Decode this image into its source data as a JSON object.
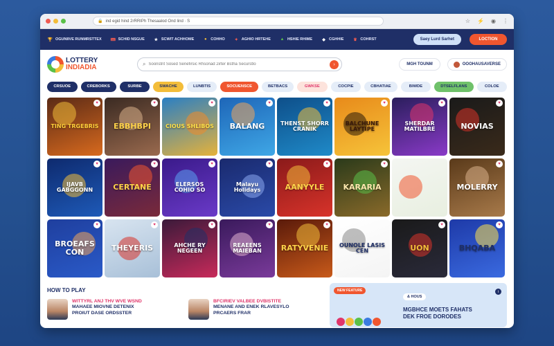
{
  "browser": {
    "url": "ind egid hind 2rRRIPh Thesaalod Ond lind · S",
    "icons": [
      "bookmark-icon",
      "extension-icon",
      "profile-icon",
      "menu-icon"
    ]
  },
  "topbar": {
    "promos": [
      {
        "label": "OGUNIIVE RUNMRSTTEX",
        "icon": "trophy-icon",
        "color": "#f3bd3a"
      },
      {
        "label": "SCHID NSGUE",
        "icon": "ticket-icon",
        "color": "#ef5b52"
      },
      {
        "label": "SCWIT ACHHOME",
        "icon": "star-icon",
        "color": "#ffffff"
      },
      {
        "label": "COHHO",
        "icon": "coin-icon",
        "color": "#f3bd3a"
      },
      {
        "label": "AGHIO HRTEHE",
        "icon": "gift-icon",
        "color": "#ef5b52"
      },
      {
        "label": "HSHIE RHIME",
        "icon": "chart-icon",
        "color": "#5ac048"
      },
      {
        "label": "CGHHIE",
        "icon": "dice-icon",
        "color": "#ffffff"
      },
      {
        "label": "COHRST",
        "icon": "crown-icon",
        "color": "#ef5b52"
      }
    ],
    "signup_label": "Saey Lurd Sarhet",
    "login_label": "LOCTION"
  },
  "header": {
    "logo_line1": "LOTTERY",
    "logo_line2": "INDIADIA",
    "search_placeholder": "Soonstnt Sosed Senefirsic Rhsonad 2irter Bstha Securstlo",
    "link1": "MGH TOUNM",
    "user_label": "OOOHAUSAVERSE"
  },
  "categories": [
    {
      "label": "CRSUOE",
      "bg": "#1f2f67",
      "fg": "#ffffff"
    },
    {
      "label": "CREBORKS",
      "bg": "#1f2f67",
      "fg": "#ffffff"
    },
    {
      "label": "SURBE",
      "bg": "#1f2f67",
      "fg": "#ffffff"
    },
    {
      "label": "SWACHE",
      "bg": "#f3bd3a",
      "fg": "#1f2f67"
    },
    {
      "label": "LUNBTIS",
      "bg": "#e5edf8",
      "fg": "#1f2f67"
    },
    {
      "label": "SOCUENSCE",
      "bg": "#f0562f",
      "fg": "#ffffff"
    },
    {
      "label": "BETBACS",
      "bg": "#e5edf8",
      "fg": "#1f2f67"
    },
    {
      "label": "GWKSE",
      "bg": "#fde3dc",
      "fg": "#e0356a"
    },
    {
      "label": "COCPIE",
      "bg": "#e5edf8",
      "fg": "#1f2f67"
    },
    {
      "label": "CBHATIAE",
      "bg": "#e5edf8",
      "fg": "#1f2f67"
    },
    {
      "label": "BIWDE",
      "bg": "#e5edf8",
      "fg": "#1f2f67"
    },
    {
      "label": "DTSELFLANS",
      "bg": "#6fc16a",
      "fg": "#1f2f67"
    },
    {
      "label": "COLOE",
      "bg": "#e5edf8",
      "fg": "#1f2f67"
    }
  ],
  "games": [
    {
      "label": "TING TRGEBRIS",
      "bg1": "#5a2a16",
      "bg2": "#d86a1e",
      "fg": "#ffcf3a",
      "deco": "#f3bd3a"
    },
    {
      "label": "EBBHBPI",
      "bg1": "#3a2a22",
      "bg2": "#9a6a4e",
      "fg": "#ffd34a",
      "deco": "#d8b08a"
    },
    {
      "label": "CIOUS SHLIBOS",
      "bg1": "#2a7fc4",
      "bg2": "#e6b23a",
      "fg": "#ffe14a",
      "deco": "#f08a2a"
    },
    {
      "label": "BALANG",
      "bg1": "#1e66b8",
      "bg2": "#3fa7e6",
      "fg": "#ffffff",
      "deco": "#f0a45a"
    },
    {
      "label": "THENST SHORR CRANIK",
      "bg1": "#0e4f8a",
      "bg2": "#1f8ac8",
      "fg": "#ffffff",
      "deco": "#f3bd3a"
    },
    {
      "label": "BALCHUNE LAYTIPE",
      "bg1": "#e88a1a",
      "bg2": "#f6c43a",
      "fg": "#3a1a0a",
      "deco": "#2a1a0a"
    },
    {
      "label": "SHERDAR MATILBRE",
      "bg1": "#2a1e5c",
      "bg2": "#8a3ac8",
      "fg": "#ffffff",
      "deco": "#e0356a"
    },
    {
      "label": "NOVIAS",
      "bg1": "#1a1a1a",
      "bg2": "#3a2a1a",
      "fg": "#ffffff",
      "deco": "#d8332a"
    },
    {
      "label": "IJAVB GABGGONN",
      "bg1": "#0e2a6e",
      "bg2": "#1e5ab8",
      "fg": "#ffffff",
      "deco": "#f3bd3a"
    },
    {
      "label": "CERTANE",
      "bg1": "#3a1a5c",
      "bg2": "#7a2a3a",
      "fg": "#ffd34a",
      "deco": "#f0562f"
    },
    {
      "label": "ELERSOS COHIO SO",
      "bg1": "#3a1a8a",
      "bg2": "#6a3ac8",
      "fg": "#ffffff",
      "deco": "#5aa0f0"
    },
    {
      "label": "Malayu Holidays",
      "bg1": "#1a2a6e",
      "bg2": "#2a4aa8",
      "fg": "#ffffff",
      "deco": "#8aa8f0"
    },
    {
      "label": "AANYYLE",
      "bg1": "#8a1a1a",
      "bg2": "#d8332a",
      "fg": "#ffd34a",
      "deco": "#f3bd3a"
    },
    {
      "label": "KARARIA",
      "bg1": "#2a3a1a",
      "bg2": "#8a6a2a",
      "fg": "#ffe9b0",
      "deco": "#5ac048"
    },
    {
      "label": "",
      "bg1": "#f4f6f2",
      "bg2": "#e8efe0",
      "fg": "#1f2f67",
      "deco": "#f0562f"
    },
    {
      "label": "MOLERRY",
      "bg1": "#5a3a1a",
      "bg2": "#a87a4a",
      "fg": "#ffffff",
      "deco": "#d8b08a"
    },
    {
      "label": "BROEAFS CON",
      "bg1": "#1f3f9e",
      "bg2": "#2a5ac8",
      "fg": "#ffffff",
      "deco": "#f0a45a"
    },
    {
      "label": "THEYERIS",
      "bg1": "#d8e4f0",
      "bg2": "#a8c0d8",
      "fg": "#ffffff",
      "deco": "#d8332a"
    },
    {
      "label": "AHCHE RY NEGEEN",
      "bg1": "#3a1a3a",
      "bg2": "#c82a5a",
      "fg": "#ffffff",
      "deco": "#1f2f67"
    },
    {
      "label": "REAEENS MAIEBAN",
      "bg1": "#3a1a5c",
      "bg2": "#7a3a9a",
      "fg": "#ffffff",
      "deco": "#e0b0d0"
    },
    {
      "label": "RATYVENIE",
      "bg1": "#5a1a0a",
      "bg2": "#c85a1a",
      "fg": "#ffd34a",
      "deco": "#f3bd3a"
    },
    {
      "label": "OUNOLE LASIS CEN",
      "bg1": "#ffffff",
      "bg2": "#f4f4f4",
      "fg": "#1f2f67",
      "deco": "#888888"
    },
    {
      "label": "UON",
      "bg1": "#1a1a1a",
      "bg2": "#2a2a3a",
      "fg": "#f3bd3a",
      "deco": "#d8332a"
    },
    {
      "label": "BHQABA",
      "bg1": "#1e3aa8",
      "bg2": "#3a6ae0",
      "fg": "#1f2f67",
      "deco": "#ffe14a"
    }
  ],
  "howto": {
    "title": "HOW TO PLAY",
    "steps": [
      {
        "line1": "WITTYRL ANJ THV WVE WSND",
        "line2": "MAHAEE MIOVNE DETENIX",
        "line3": "PROIUT DASE ORDSSTER"
      },
      {
        "line1": "BFCIRIEV VALBEE DVBISTITE",
        "line2": "MENANE AND ENEK RLAVESYLO",
        "line3": "PRCAERS FRAR"
      }
    ]
  },
  "promo_card": {
    "tag": "NEW FEATURE",
    "chip": "& HOUS",
    "title_line1": "MGBHCE MOETS FAHATS",
    "title_line2": "DEK FROE DORODES",
    "info_icon": "i"
  }
}
